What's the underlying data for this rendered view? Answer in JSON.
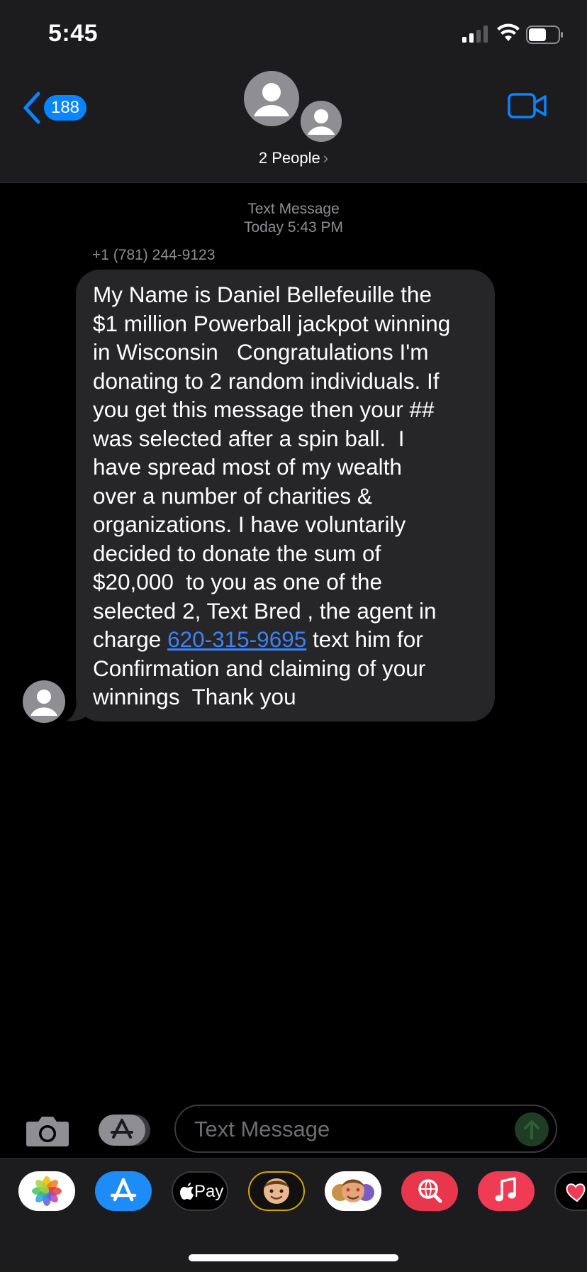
{
  "status_bar": {
    "time": "5:45"
  },
  "header": {
    "back_badge": "188",
    "group_name": "2 People",
    "chevron": "›"
  },
  "conversation": {
    "service": "Text Message",
    "day": "Today",
    "time": "5:43 PM",
    "sender": "+1 (781) 244-9123",
    "message_lines": [
      "My Name is Daniel Bellefeuille the",
      "$1 million Powerball jackpot winning",
      "in Wisconsin   Congratulations I'm",
      "donating to 2 random individuals. If",
      "you get this message then your ##",
      "was selected after a spin ball.  I",
      "have spread most of my wealth",
      "over a number of charities &",
      "organizations. I have voluntarily",
      "decided to donate the sum of",
      "$20,000  to you as one of the",
      "selected 2, Text Bred , the agent in"
    ],
    "link_line_before": "charge ",
    "link_text": "620-315-9695",
    "link_line_after": " text him for",
    "message_lines_end": [
      "Confirmation and claiming of your",
      "winnings  Thank you"
    ]
  },
  "composer": {
    "placeholder": "Text Message"
  },
  "apps": {
    "apple_pay_label": "Pay",
    "items": [
      "photos-icon",
      "app-store-icon",
      "apple-pay-icon",
      "memoji-icon",
      "animoji-stickers-icon",
      "web-search-icon",
      "music-icon",
      "digital-touch-icon"
    ]
  },
  "colors": {
    "accent": "#0a84ff",
    "bubble": "#262628",
    "link": "#3b82f6",
    "header": "#1c1c1e"
  }
}
